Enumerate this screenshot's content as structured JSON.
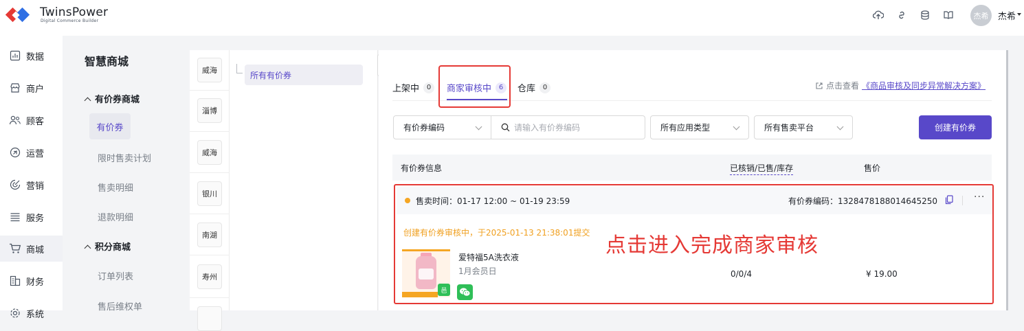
{
  "header": {
    "logo_text": "TwinsPower",
    "logo_subtitle": "Digital Commerce Builder",
    "icons": [
      "cloud-upload-icon",
      "link-icon",
      "database-icon",
      "book-icon"
    ],
    "avatar_text": "杰希",
    "username": "杰希"
  },
  "nav": {
    "items": [
      {
        "label": "数据",
        "icon": "chart-icon"
      },
      {
        "label": "商户",
        "icon": "store-icon"
      },
      {
        "label": "顾客",
        "icon": "users-icon"
      },
      {
        "label": "运营",
        "icon": "operations-icon"
      },
      {
        "label": "营销",
        "icon": "marketing-icon"
      },
      {
        "label": "服务",
        "icon": "list-icon"
      },
      {
        "label": "商城",
        "icon": "cart-icon"
      },
      {
        "label": "财务",
        "icon": "finance-icon"
      },
      {
        "label": "系统",
        "icon": "system-icon"
      }
    ],
    "active": "商城"
  },
  "submenu": {
    "title": "智慧商城",
    "groups": [
      {
        "label": "有价券商城",
        "items": [
          "有价券",
          "限时售卖计划",
          "售卖明细",
          "退款明细"
        ]
      },
      {
        "label": "积分商城",
        "items": [
          "订单列表",
          "售后维权单"
        ]
      }
    ],
    "active_item": "有价券"
  },
  "cities": [
    "威海",
    "淄博",
    "威海",
    "银川",
    "南湖",
    "寿州",
    ""
  ],
  "tree": {
    "item": "所有有价券"
  },
  "tabs": [
    {
      "label": "上架中",
      "count": "0"
    },
    {
      "label": "商家审核中",
      "count": "6"
    },
    {
      "label": "仓库",
      "count": "0"
    }
  ],
  "active_tab": "商家审核中",
  "help": {
    "prefix": "点击查看",
    "link": "《商品审核及同步异常解决方案》"
  },
  "filters": {
    "code_select": "有价券编码",
    "search_placeholder": "请输入有价券编码",
    "app_type": "所有应用类型",
    "platform": "所有售卖平台",
    "create_button": "创建有价券"
  },
  "table": {
    "headers": [
      "有价券信息",
      "已核销/已售/库存",
      "售价"
    ]
  },
  "coupon": {
    "sale_time": "售卖时间：01-17 12:00 ~ 01-19 23:59",
    "code": "有价券编码：1328478188014645250",
    "status": "创建有价券审核中，于2025-01-13 21:38:01提交",
    "name": "爱特福5A洗衣液",
    "subtitle": "1月会员日",
    "stock": "0/0/4",
    "price": "¥ 19.00",
    "thumb_tag": "邑"
  },
  "annotation": "点击进入完成商家审核",
  "colors": {
    "accent": "#5848c9",
    "highlight": "#e53935",
    "warning": "#f0a020"
  }
}
